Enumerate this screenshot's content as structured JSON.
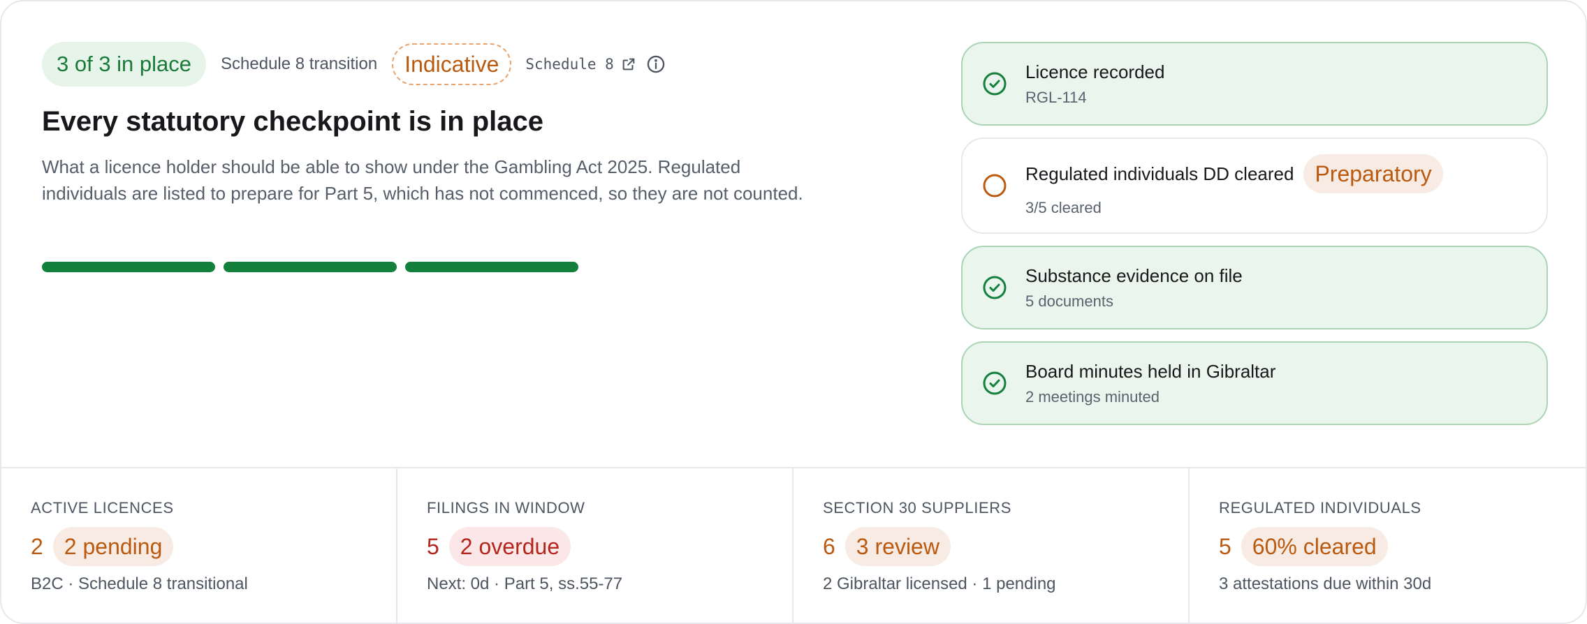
{
  "header": {
    "status_pill": "3 of 3 in place",
    "context": "Schedule 8 transition",
    "indicative_tag": "Indicative",
    "schedule_link": "Schedule 8",
    "icons": {
      "external_link": "external-link-icon",
      "info": "info-icon"
    }
  },
  "summary": {
    "title": "Every statutory checkpoint is in place",
    "description": "What a licence holder should be able to show under the Gambling Act 2025. Regulated individuals are listed to prepare for Part 5, which has not commenced, so they are not counted.",
    "progress": {
      "completed": 3,
      "total": 3
    }
  },
  "checklist": [
    {
      "label": "Licence recorded",
      "detail": "RGL-114",
      "status": "done",
      "icon": "check-circle-icon"
    },
    {
      "label": "Regulated individuals DD cleared",
      "detail": "3/5 cleared",
      "status": "pending",
      "icon": "empty-circle-icon",
      "tag": "Preparatory"
    },
    {
      "label": "Substance evidence on file",
      "detail": "5 documents",
      "status": "done",
      "icon": "check-circle-icon"
    },
    {
      "label": "Board minutes held in Gibraltar",
      "detail": "2 meetings minuted",
      "status": "done",
      "icon": "check-circle-icon"
    }
  ],
  "stats": [
    {
      "label": "ACTIVE LICENCES",
      "value": "2",
      "badge": "2 pending",
      "note": "B2C · Schedule 8 transitional",
      "tone": "orange"
    },
    {
      "label": "FILINGS IN WINDOW",
      "value": "5",
      "badge": "2 overdue",
      "note": "Next: 0d · Part 5, ss.55-77",
      "tone": "red"
    },
    {
      "label": "SECTION 30 SUPPLIERS",
      "value": "6",
      "badge": "3 review",
      "note": "2 Gibraltar licensed · 1 pending",
      "tone": "orange"
    },
    {
      "label": "REGULATED INDIVIDUALS",
      "value": "5",
      "badge": "60% cleared",
      "note": "3 attestations due within 30d",
      "tone": "orange"
    }
  ],
  "colors": {
    "success": "#13803c",
    "success_bg": "#e7f4ea",
    "warning": "#b95a10",
    "warning_bg": "#f8ebe3",
    "danger": "#b3261e",
    "danger_bg": "#fbe7e7",
    "border": "#e6e8eb"
  }
}
